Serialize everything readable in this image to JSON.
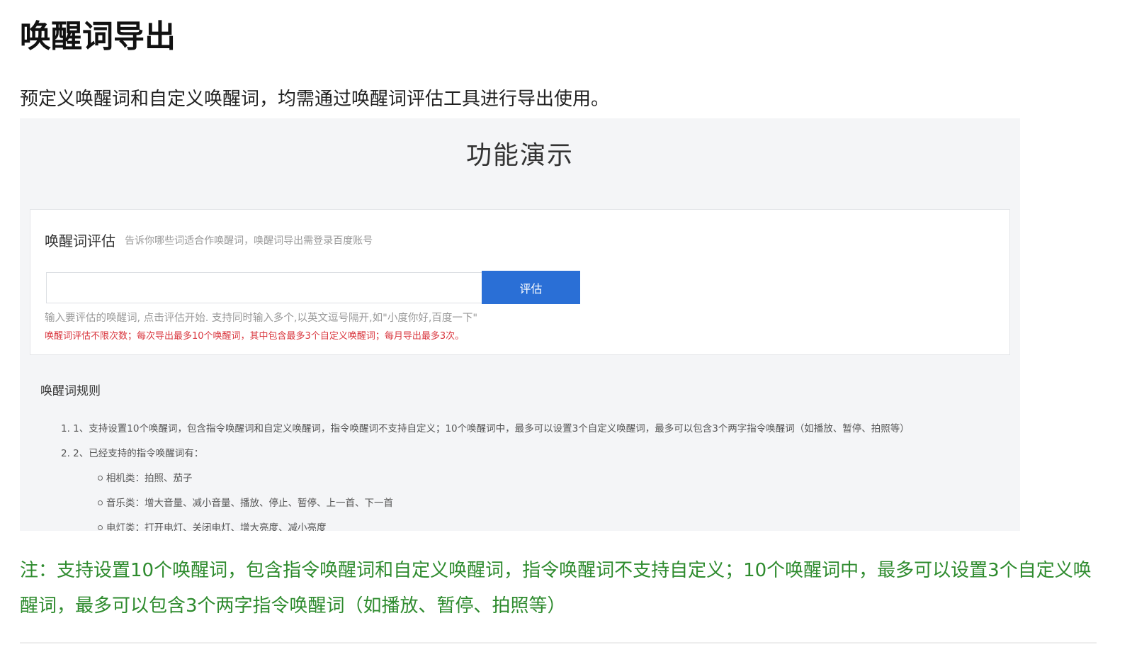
{
  "page": {
    "title": "唤醒词导出",
    "intro": "预定义唤醒词和自定义唤醒词，均需通过唤醒词评估工具进行导出使用。",
    "note": "注：支持设置10个唤醒词，包含指令唤醒词和自定义唤醒词，指令唤醒词不支持自定义；10个唤醒词中，最多可以设置3个自定义唤醒词，最多可以包含3个两字指令唤醒词（如播放、暂停、拍照等）"
  },
  "demo": {
    "title": "功能演示",
    "card": {
      "title": "唤醒词评估",
      "subtitle": "告诉你哪些词适合作唤醒词，唤醒词导出需登录百度账号",
      "input_value": "",
      "button_label": "评估",
      "hint": "输入要评估的唤醒词, 点击评估开始. 支持同时输入多个,以英文逗号隔开,如\"小度你好,百度一下\"",
      "limit": "唤醒词评估不限次数；每次导出最多10个唤醒词，其中包含最多3个自定义唤醒词；每月导出最多3次。"
    },
    "rules": {
      "title": "唤醒词规则",
      "items": [
        "1. 1、支持设置10个唤醒词，包含指令唤醒词和自定义唤醒词，指令唤醒词不支持自定义；10个唤醒词中，最多可以设置3个自定义唤醒词，最多可以包含3个两字指令唤醒词（如播放、暂停、拍照等）",
        "2. 2、已经支持的指令唤醒词有："
      ],
      "subitems": [
        "相机类：拍照、茄子",
        "音乐类：增大音量、减小音量、播放、停止、暂停、上一首、下一首",
        "电灯类：打开电灯、关闭电灯、增大亮度、减小亮度"
      ]
    }
  },
  "colors": {
    "accent_button": "#2a6fd6",
    "limit_text": "#d9363e",
    "note_text": "#2e8b2e",
    "demo_bg": "#f4f5f7"
  }
}
